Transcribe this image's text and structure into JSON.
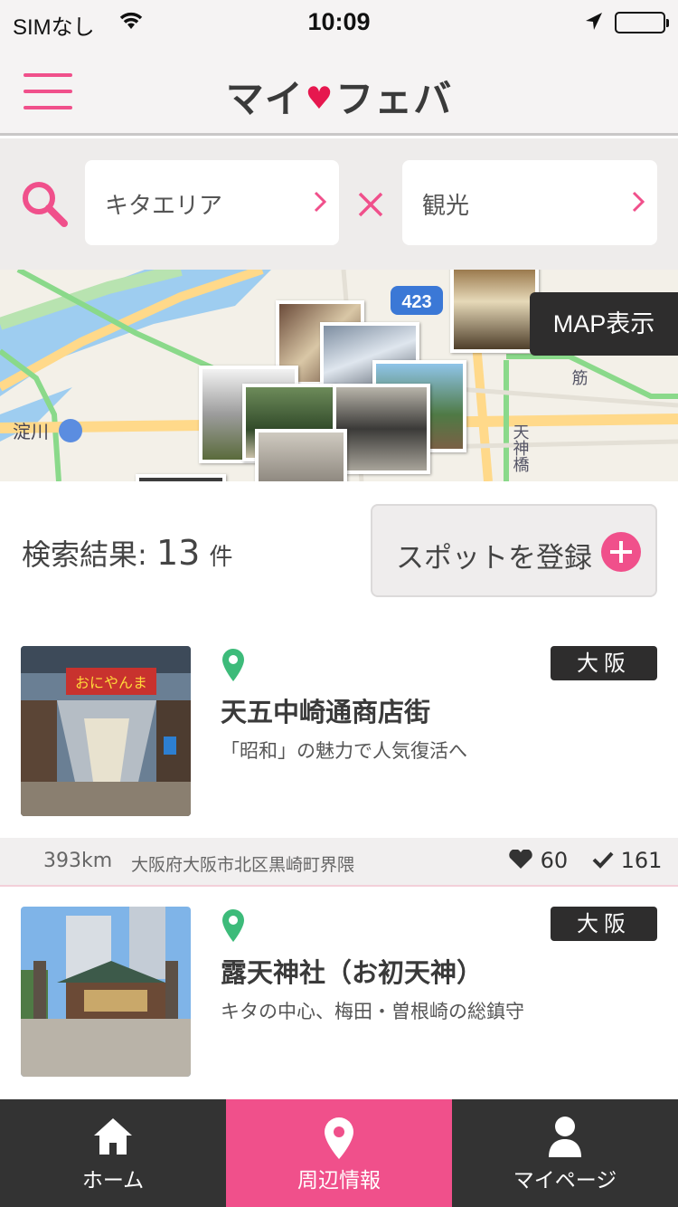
{
  "status_bar": {
    "carrier": "SIMなし",
    "time": "10:09"
  },
  "header": {
    "logo_left": "マイ",
    "logo_right": "フェバ"
  },
  "search": {
    "area": "キタエリア",
    "category": "観光"
  },
  "map": {
    "button_label": "MAP表示"
  },
  "results": {
    "label": "検索結果:",
    "count": "13",
    "unit": "件",
    "register_button": "スポットを登録"
  },
  "spots": [
    {
      "badge": "大阪",
      "name": "天五中崎通商店街",
      "catch": "「昭和」の魅力で人気復活へ",
      "distance": "393km",
      "address": "大阪府大阪市北区黒崎町界隈",
      "likes": "60",
      "checkins": "161"
    },
    {
      "badge": "大阪",
      "name": "露天神社（お初天神）",
      "catch": "キタの中心、梅田・曽根崎の総鎮守"
    }
  ],
  "tabs": [
    {
      "label": "ホーム",
      "icon": "home-icon"
    },
    {
      "label": "周辺情報",
      "icon": "location-pin-icon",
      "active": true
    },
    {
      "label": "マイページ",
      "icon": "person-icon"
    }
  ],
  "colors": {
    "accent": "#f0508b",
    "dark": "#2e2d2d",
    "pin": "#3dbb7a"
  }
}
